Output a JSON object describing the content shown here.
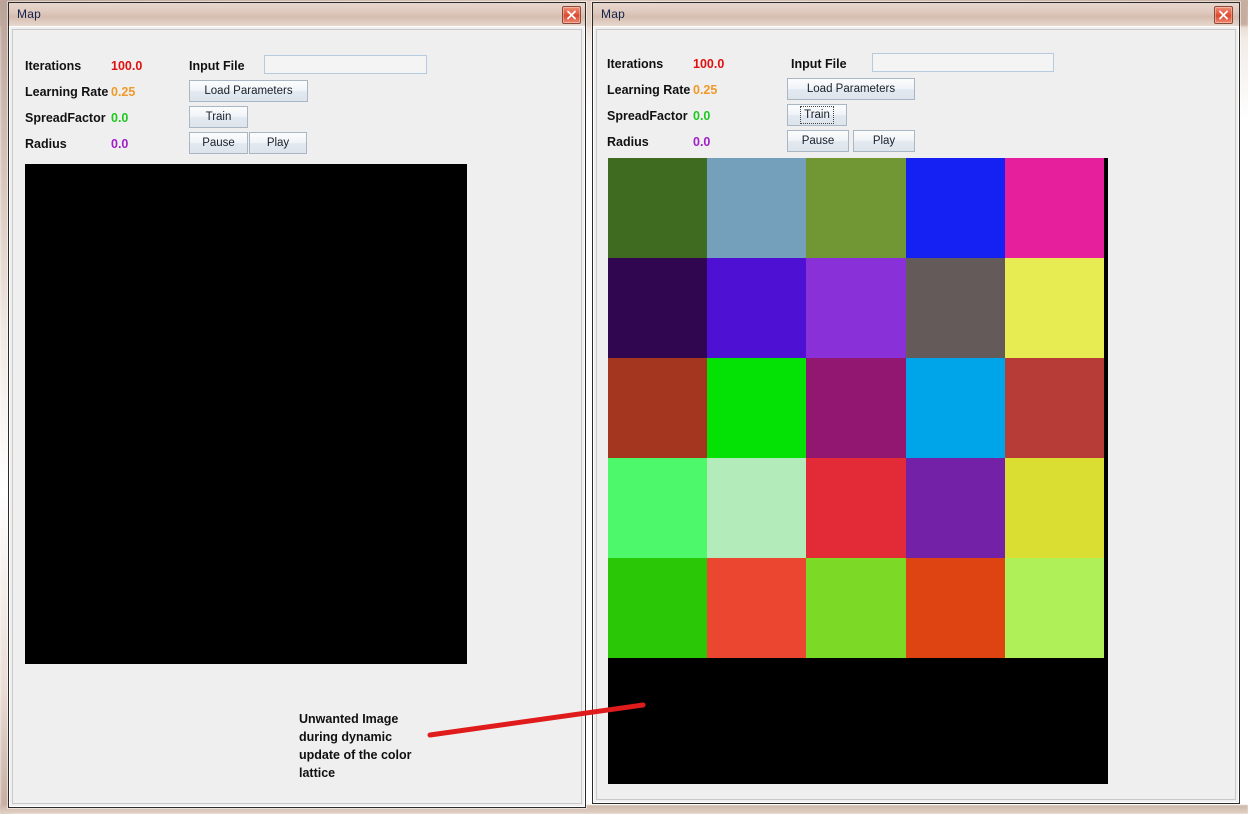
{
  "windows": [
    {
      "id": "left",
      "title": "Map",
      "close_label": "x",
      "params": [
        {
          "label": "Iterations",
          "value": "100.0",
          "color": "#e11010"
        },
        {
          "label": "Learning Rate",
          "value": "0.25",
          "color": "#ef9a2a"
        },
        {
          "label": "SpreadFactor",
          "value": "0.0",
          "color": "#1ec81e"
        },
        {
          "label": "Radius",
          "value": "0.0",
          "color": "#a020c8"
        }
      ],
      "input_file": {
        "label": "Input File",
        "value": "",
        "placeholder": ""
      },
      "buttons": [
        {
          "name": "load-parameters",
          "label": "Load Parameters",
          "focused": false
        },
        {
          "name": "train",
          "label": "Train",
          "focused": false
        },
        {
          "name": "pause",
          "label": "Pause",
          "focused": false
        },
        {
          "name": "play",
          "label": "Play",
          "focused": false
        }
      ],
      "canvas": {
        "type": "black",
        "description": "blank black lattice canvas"
      }
    },
    {
      "id": "right",
      "title": "Map",
      "close_label": "x",
      "params": [
        {
          "label": "Iterations",
          "value": "100.0",
          "color": "#e11010"
        },
        {
          "label": "Learning Rate",
          "value": "0.25",
          "color": "#ef9a2a"
        },
        {
          "label": "SpreadFactor",
          "value": "0.0",
          "color": "#1ec81e"
        },
        {
          "label": "Radius",
          "value": "0.0",
          "color": "#a020c8"
        }
      ],
      "input_file": {
        "label": "Input File",
        "value": "",
        "placeholder": ""
      },
      "buttons": [
        {
          "name": "load-parameters",
          "label": "Load Parameters",
          "focused": false
        },
        {
          "name": "train",
          "label": "Train",
          "focused": true
        },
        {
          "name": "pause",
          "label": "Pause",
          "focused": false
        },
        {
          "name": "play",
          "label": "Play",
          "focused": false
        }
      ],
      "canvas": {
        "type": "lattice",
        "description": "5x5 color lattice with black remainder"
      }
    }
  ],
  "lattice": {
    "rows": 5,
    "cols": 5,
    "colors": [
      [
        "#3E6B20",
        "#74A0BB",
        "#719634",
        "#1421F2",
        "#E6209D"
      ],
      [
        "#310650",
        "#4E10D2",
        "#8930D8",
        "#645A59",
        "#E7EC52"
      ],
      [
        "#A4361F",
        "#04E104",
        "#911770",
        "#00A4E8",
        "#B73B36"
      ],
      [
        "#4DF96A",
        "#B4EBBA",
        "#E32B37",
        "#7322A8",
        "#DBDE32"
      ],
      [
        "#2AC706",
        "#EB4630",
        "#7CDA26",
        "#DE4412",
        "#AFF058"
      ]
    ]
  },
  "annotation": {
    "text": "Unwanted Image during dynamic update of the color lattice",
    "arrow_color": "#E01B1B"
  }
}
